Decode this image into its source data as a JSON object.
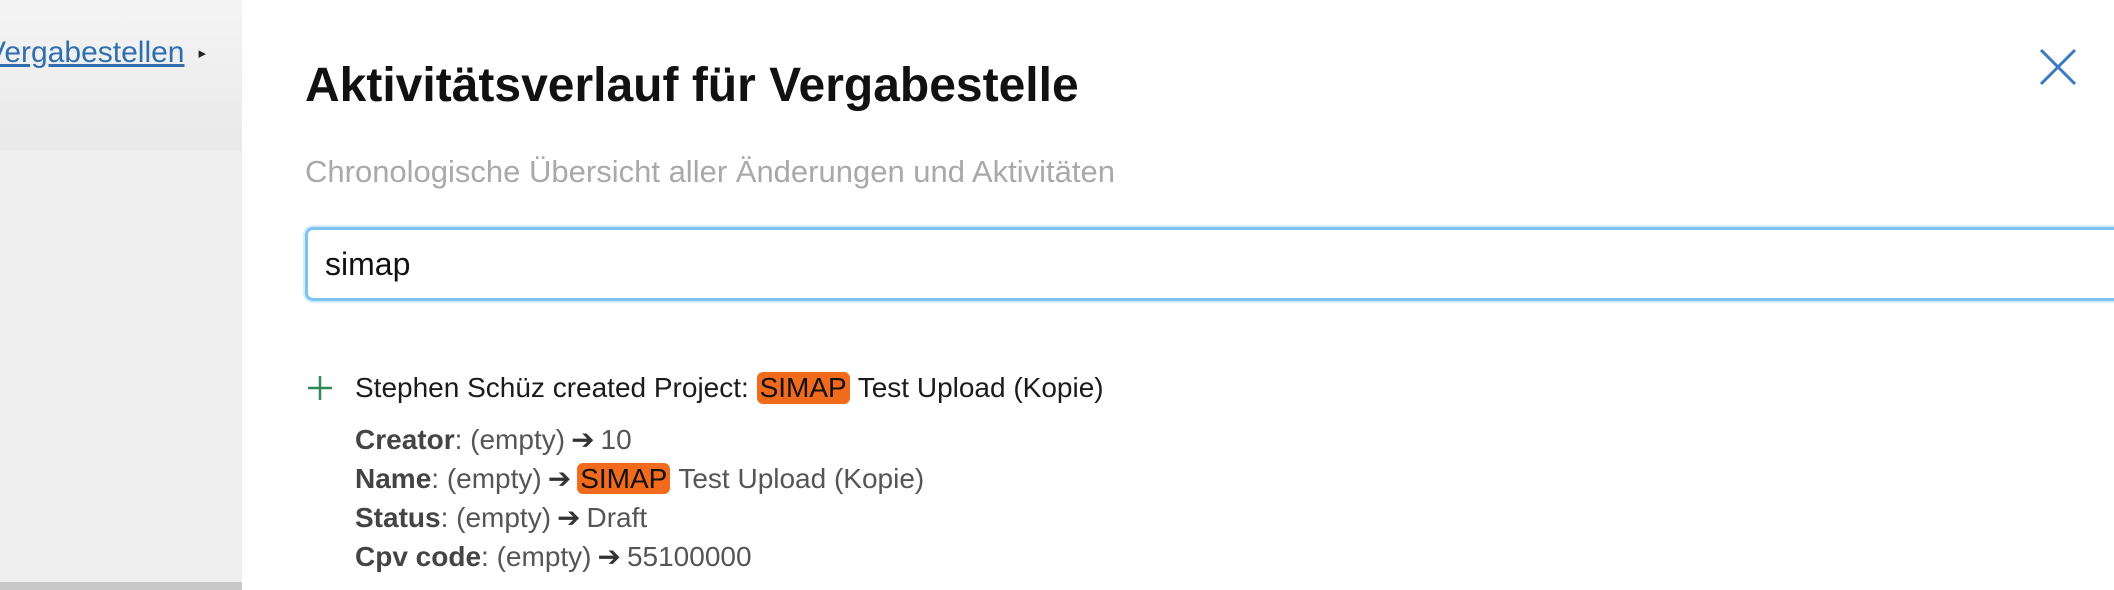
{
  "breadcrumb": {
    "label": "Vergabestellen",
    "arrow": "▸"
  },
  "panel": {
    "title": "Aktivitätsverlauf für Vergabestelle",
    "subtitle": "Chronologische Übersicht aller Änderungen und Aktivitäten",
    "search": {
      "value": "simap",
      "icon": "search-icon"
    },
    "close_icon": "close-icon"
  },
  "activity": {
    "icon": "plus-icon",
    "actor_action": "Stephen Schüz created Project:",
    "highlight": "SIMAP",
    "rest": "Test Upload (Kopie)",
    "arrow": "➔",
    "changes": [
      {
        "field": "Creator",
        "old": "(empty)",
        "new": "10"
      },
      {
        "field": "Name",
        "old": "(empty)",
        "new_highlight": "SIMAP",
        "new": "Test Upload (Kopie)"
      },
      {
        "field": "Status",
        "old": "(empty)",
        "new": "Draft"
      },
      {
        "field": "Cpv code",
        "old": "(empty)",
        "new": "55100000"
      }
    ]
  },
  "colors": {
    "highlight": "#f26a1b",
    "link": "#2f6fb0",
    "focus_border": "#7cc3f1",
    "plus_icon": "#2e8b57"
  }
}
